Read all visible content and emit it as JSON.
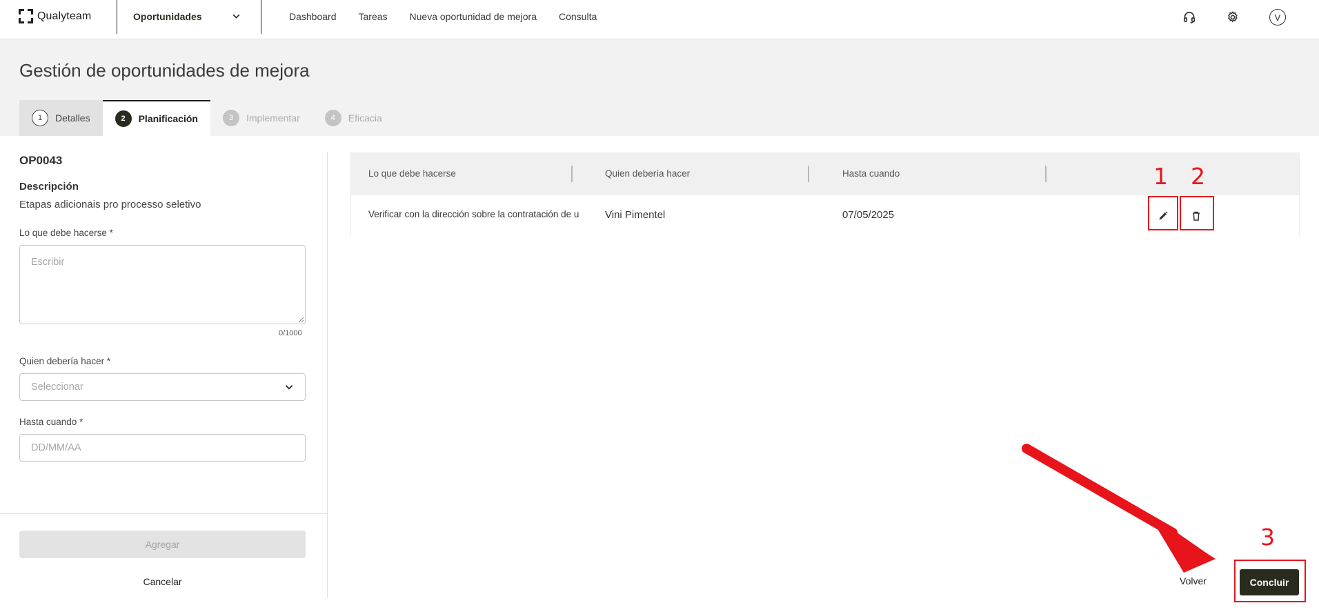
{
  "topbar": {
    "logo_text": "Qualyteam",
    "module": "Oportunidades",
    "nav": [
      "Dashboard",
      "Tareas",
      "Nueva oportunidad de mejora",
      "Consulta"
    ],
    "icons": [
      "headset-icon",
      "gear-icon"
    ],
    "avatar_initial": "V"
  },
  "header": {
    "title": "Gestión de oportunidades de mejora",
    "tabs": [
      {
        "num": "1",
        "label": "Detalles",
        "state": "done"
      },
      {
        "num": "2",
        "label": "Planificación",
        "state": "active"
      },
      {
        "num": "3",
        "label": "Implementar",
        "state": "pending"
      },
      {
        "num": "4",
        "label": "Eficacia",
        "state": "pending"
      }
    ]
  },
  "form": {
    "code": "OP0043",
    "description_label": "Descripción",
    "description": "Etapas adicionais pro processo seletivo",
    "what_label": "Lo que debe hacerse *",
    "what_placeholder": "Escribir",
    "what_counter": "0/1000",
    "who_label": "Quien debería hacer *",
    "who_placeholder": "Seleccionar",
    "until_label": "Hasta cuando *",
    "until_placeholder": "DD/MM/AA",
    "add_button": "Agregar",
    "cancel_button": "Cancelar"
  },
  "table": {
    "headers": [
      "Lo que debe hacerse",
      "Quien debería hacer",
      "Hasta cuando"
    ],
    "rows": [
      {
        "what": "Verificar con la dirección sobre la contratación de u",
        "who": "Vini Pimentel",
        "until": "07/05/2025"
      }
    ]
  },
  "annotations": {
    "labels": [
      "1",
      "2",
      "3"
    ],
    "color": "#e8141b"
  },
  "actions": {
    "back": "Volver",
    "conclude": "Concluir"
  },
  "colors": {
    "primary_dark": "#2a2b1f",
    "header_bg": "#f2f2f2",
    "annotation": "#e8141b"
  }
}
